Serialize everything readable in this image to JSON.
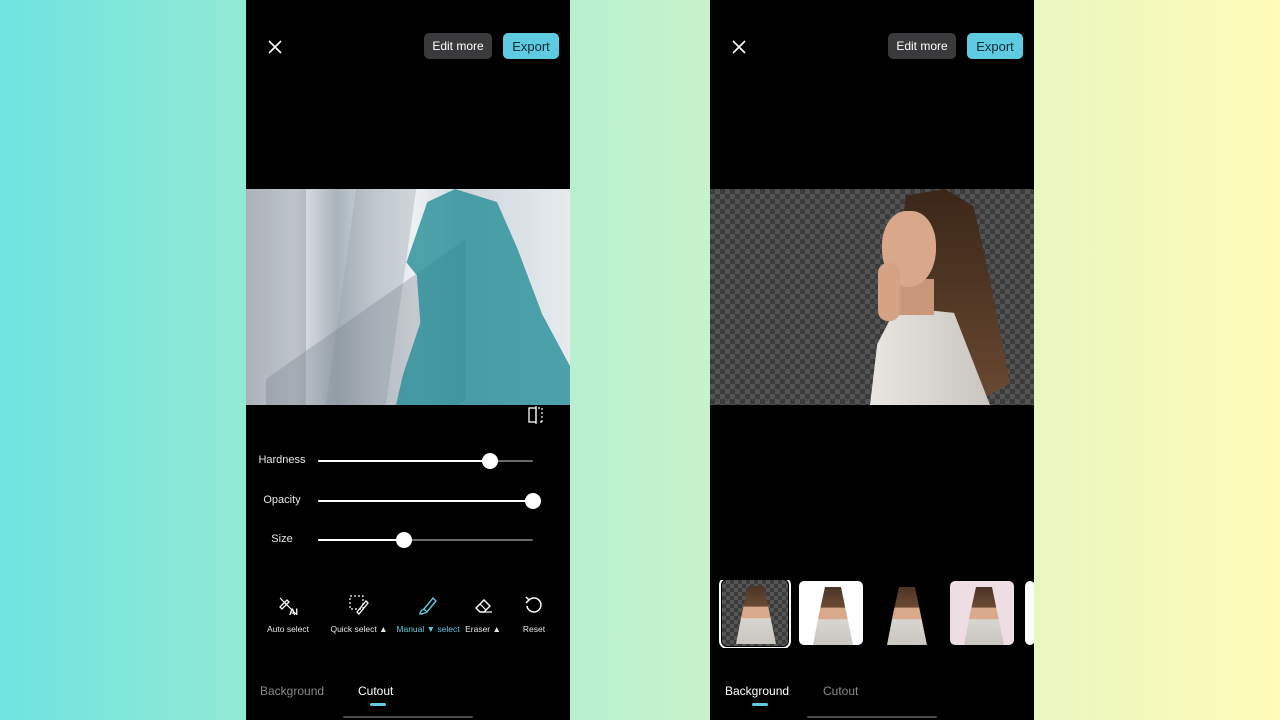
{
  "left_screen": {
    "header": {
      "edit_more_label": "Edit more",
      "export_label": "Export"
    },
    "sliders": [
      {
        "label": "Hardness",
        "value": 0.8
      },
      {
        "label": "Opacity",
        "value": 1.0
      },
      {
        "label": "Size",
        "value": 0.4
      }
    ],
    "tools": [
      {
        "label": "Auto select",
        "icon": "auto-select-ai-icon"
      },
      {
        "label": "Quick select ▲",
        "icon": "quick-select-icon"
      },
      {
        "label": "Manual ▼ select",
        "icon": "brush-icon",
        "active": true
      },
      {
        "label": "Eraser ▲",
        "icon": "eraser-icon"
      },
      {
        "label": "Reset",
        "icon": "reset-icon"
      }
    ],
    "tabs": [
      {
        "label": "Background",
        "active": false
      },
      {
        "label": "Cutout",
        "active": true
      }
    ]
  },
  "right_screen": {
    "header": {
      "edit_more_label": "Edit more",
      "export_label": "Export"
    },
    "background_options": [
      "transparent",
      "white",
      "transparent-dark",
      "pink"
    ],
    "selected_background_index": 0,
    "tabs": [
      {
        "label": "Background",
        "active": true
      },
      {
        "label": "Cutout",
        "active": false
      }
    ]
  },
  "colors": {
    "accent": "#5ecbe1",
    "panel": "#000000",
    "button_dark": "#3a3a3c"
  }
}
